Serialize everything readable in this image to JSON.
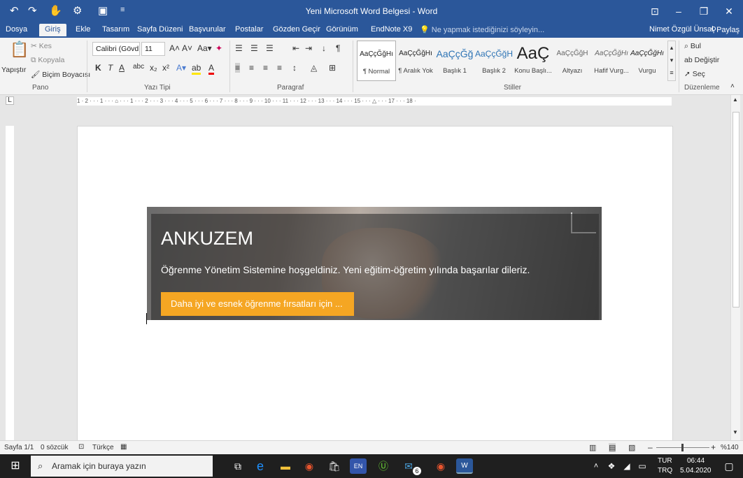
{
  "titlebar": {
    "doc_title": "Yeni Microsoft Word Belgesi - Word",
    "undo_icon": "undo-icon",
    "redo_icon": "redo-icon"
  },
  "tabs": {
    "items": [
      "Dosya",
      "Giriş",
      "Ekle",
      "Tasarım",
      "Sayfa Düzeni",
      "Başvurular",
      "Postalar",
      "Gözden Geçir",
      "Görünüm",
      "EndNote X9"
    ],
    "tell_me": "Ne yapmak istediğinizi söyleyin...",
    "user": "Nimet Özgül Ünsal",
    "share": "Paylaş"
  },
  "ribbon": {
    "clipboard": {
      "paste": "Yapıştır",
      "cut": "Kes",
      "copy": "Kopyala",
      "format_painter": "Biçim Boyacısı",
      "label": "Pano"
    },
    "font": {
      "family": "Calibri (Gövd",
      "size": "11",
      "label": "Yazı Tipi"
    },
    "paragraph": {
      "label": "Paragraf"
    },
    "styles": {
      "label": "Stiller",
      "items": [
        {
          "sample": "AaÇçĞğHı",
          "name": "¶ Normal"
        },
        {
          "sample": "AaÇçĞğHı",
          "name": "¶ Aralık Yok"
        },
        {
          "sample": "AaÇçĞğ",
          "name": "Başlık 1"
        },
        {
          "sample": "AaÇçĞğH",
          "name": "Başlık 2"
        },
        {
          "sample": "AaÇ",
          "name": "Konu Başlı..."
        },
        {
          "sample": "AaÇçĞğH",
          "name": "Altyazı"
        },
        {
          "sample": "AaÇçĞğHı",
          "name": "Hafif Vurg..."
        },
        {
          "sample": "AaÇçĞğHı",
          "name": "Vurgu"
        }
      ]
    },
    "editing": {
      "find": "Bul",
      "replace": "Değiştir",
      "select": "Seç",
      "label": "Düzenleme"
    }
  },
  "ruler": {
    "scale": "1 · 2 · · · 1 · · · ⌂ · · · 1 · · · 2 · · · 3 · · · 4 · · · 5 · · · 6 · · · 7 · · · 8 · · · 9 · · · 10 · · · 11 · · · 12 · · · 13 · · · 14 · · · 15 · · · △ · · · 17 · · · 18 ·"
  },
  "banner": {
    "title": "ANKUZEM",
    "subtitle": "Öğrenme Yönetim Sistemine hoşgeldiniz. Yeni eğitim-öğretim yılında başarılar dileriz.",
    "cta": "Daha iyi ve esnek öğrenme fırsatları için ..."
  },
  "statusbar": {
    "page": "Sayfa 1/1",
    "words": "0 sözcük",
    "language": "Türkçe",
    "zoom": "%140"
  },
  "taskbar": {
    "search_placeholder": "Aramak için buraya yazın",
    "lang1": "TUR",
    "lang2": "TRQ",
    "time": "06:44",
    "date": "5.04.2020",
    "mail_badge": "6"
  },
  "colors": {
    "word_blue": "#2b579a",
    "accent_orange": "#f5a623",
    "taskbar": "#1f1f1f"
  }
}
